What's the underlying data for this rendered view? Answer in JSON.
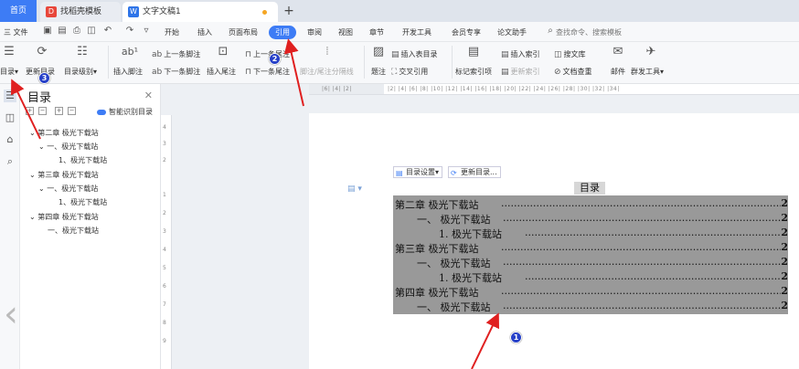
{
  "tabbar": {
    "home": "首页",
    "tab1": "找稻壳模板",
    "tab2": "文字文稿1",
    "new_tab": "+"
  },
  "menubar": {
    "file": "三 文件",
    "items": [
      "开始",
      "插入",
      "页面布局",
      "引用",
      "审阅",
      "视图",
      "章节",
      "开发工具",
      "会员专享",
      "论文助手"
    ],
    "active": "引用",
    "search": "查找命令、搜索模板"
  },
  "ribbon": {
    "toc": "目录",
    "update_toc": "更新目录",
    "toc_level": "目录级别",
    "insert_footnote": "插入脚注",
    "prev_footnote": "上一条脚注",
    "next_footnote": "下一条脚注",
    "insert_endnote": "插入尾注",
    "prev_endnote": "上一条尾注",
    "next_endnote": "下一条尾注",
    "footnote_sep": "脚注/尾注分隔线",
    "caption": "题注",
    "insert_table_toc": "插入表目录",
    "cross_ref": "交叉引用",
    "mark_index": "标记索引项",
    "insert_index": "插入索引",
    "update_index": "更新索引",
    "search_lib": "搜文库",
    "doc_check": "文档查重",
    "mail": "邮件",
    "mass_tools": "群发工具"
  },
  "toc_pane": {
    "title": "目录",
    "smart": "智能识别目录",
    "items": [
      {
        "label": "第二章 极光下载站"
      },
      {
        "label": "一、极光下载站"
      },
      {
        "label": "1、极光下载站"
      },
      {
        "label": "第三章 极光下载站"
      },
      {
        "label": "一、极光下载站"
      },
      {
        "label": "1、极光下载站"
      },
      {
        "label": "第四章 极光下载站"
      },
      {
        "label": "一、极光下载站"
      }
    ]
  },
  "document": {
    "toc_settings": "目录设置",
    "update_toc": "更新目录...",
    "heading": "目录",
    "toc_lines": [
      {
        "text": "第二章  极光下载站",
        "page": "2"
      },
      {
        "text": "一、  极光下载站",
        "page": "2"
      },
      {
        "text": "1.   极光下载站",
        "page": "2"
      },
      {
        "text": "第三章  极光下载站",
        "page": "2"
      },
      {
        "text": "一、  极光下载站",
        "page": "2"
      },
      {
        "text": "1.   极光下载站",
        "page": "2"
      },
      {
        "text": "第四章  极光下载站",
        "page": "2"
      },
      {
        "text": "一、  极光下载站",
        "page": "2"
      }
    ]
  },
  "annotations": {
    "b1": "1",
    "b2": "2",
    "b3": "3"
  },
  "colors": {
    "accent": "#3d7cf5",
    "toc_highlight": "#999999",
    "arrow": "#e02020",
    "badge": "#2640c8"
  }
}
